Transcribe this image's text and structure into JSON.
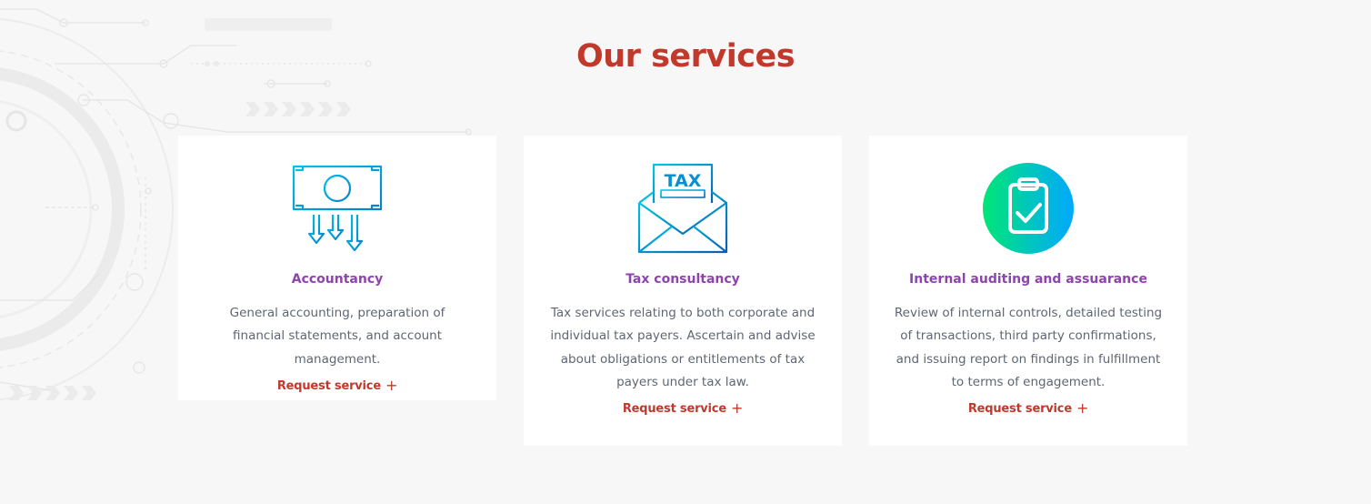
{
  "section": {
    "title": "Our services"
  },
  "colors": {
    "title": "#c0392b",
    "card_title": "#8e44ad",
    "link": "#c0392b",
    "text": "#5f6672",
    "icon_gradient_start": "#00e676",
    "icon_gradient_end": "#00a8ff"
  },
  "services": [
    {
      "icon": "money-arrows-icon",
      "title": "Accountancy",
      "description": "General accounting, preparation of financial statements, and account management.",
      "link_label": "Request service"
    },
    {
      "icon": "tax-envelope-icon",
      "icon_text": "TAX",
      "title": "Tax consultancy",
      "description": "Tax services relating to both corporate and individual tax payers. Ascertain and advise about obligations or entitlements of tax payers under tax law.",
      "link_label": "Request service"
    },
    {
      "icon": "clipboard-check-icon",
      "title": "Internal auditing and assuarance",
      "description": "Review of internal controls, detailed testing of transactions, third party confirmations, and issuing report on findings in fulfillment to terms of engagement.",
      "link_label": "Request service"
    }
  ]
}
